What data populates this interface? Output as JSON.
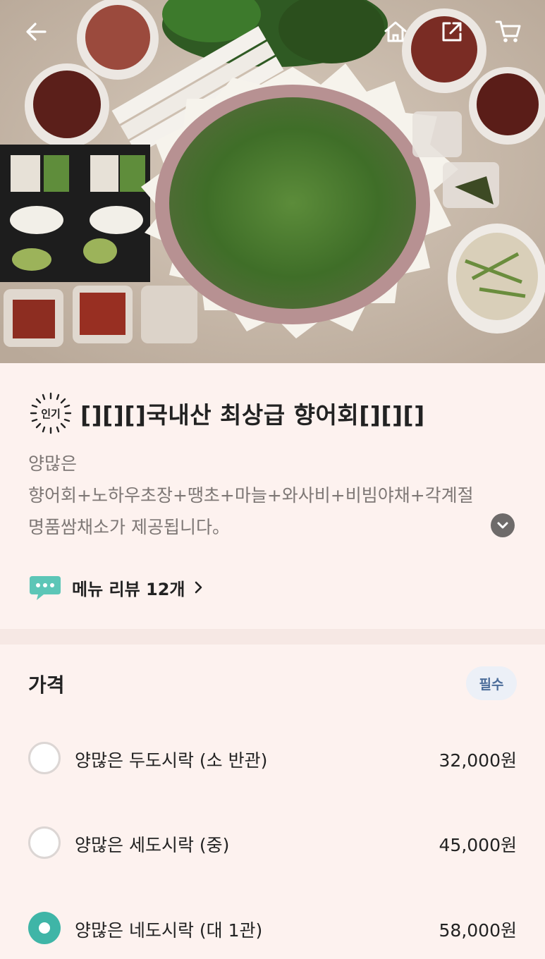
{
  "header": {
    "back_icon": "arrow-left-icon",
    "home_icon": "home-icon",
    "share_icon": "share-icon",
    "cart_icon": "cart-icon"
  },
  "menu": {
    "badge": "인기",
    "title": "[][][]국내산 최상급 향어회[][][]",
    "description_lines": [
      "양많은",
      "향어회+노하우초장+땡초+마늘+와사비+비빔야채+각계절",
      "명품쌈채소가  제공됩니다。"
    ],
    "review_label": "메뉴 리뷰 12개"
  },
  "price_section": {
    "title": "가격",
    "required_label": "필수",
    "options": [
      {
        "label": "양많은 두도시락 (소 반관)",
        "price": "32,000원",
        "selected": false
      },
      {
        "label": "양많은 세도시락 (중)",
        "price": "45,000원",
        "selected": false
      },
      {
        "label": "양많은 네도시락 (대 1관)",
        "price": "58,000원",
        "selected": true
      }
    ]
  },
  "colors": {
    "accent": "#3fb5a7",
    "background": "#fdf2ef",
    "required_text": "#4c6d9a"
  }
}
